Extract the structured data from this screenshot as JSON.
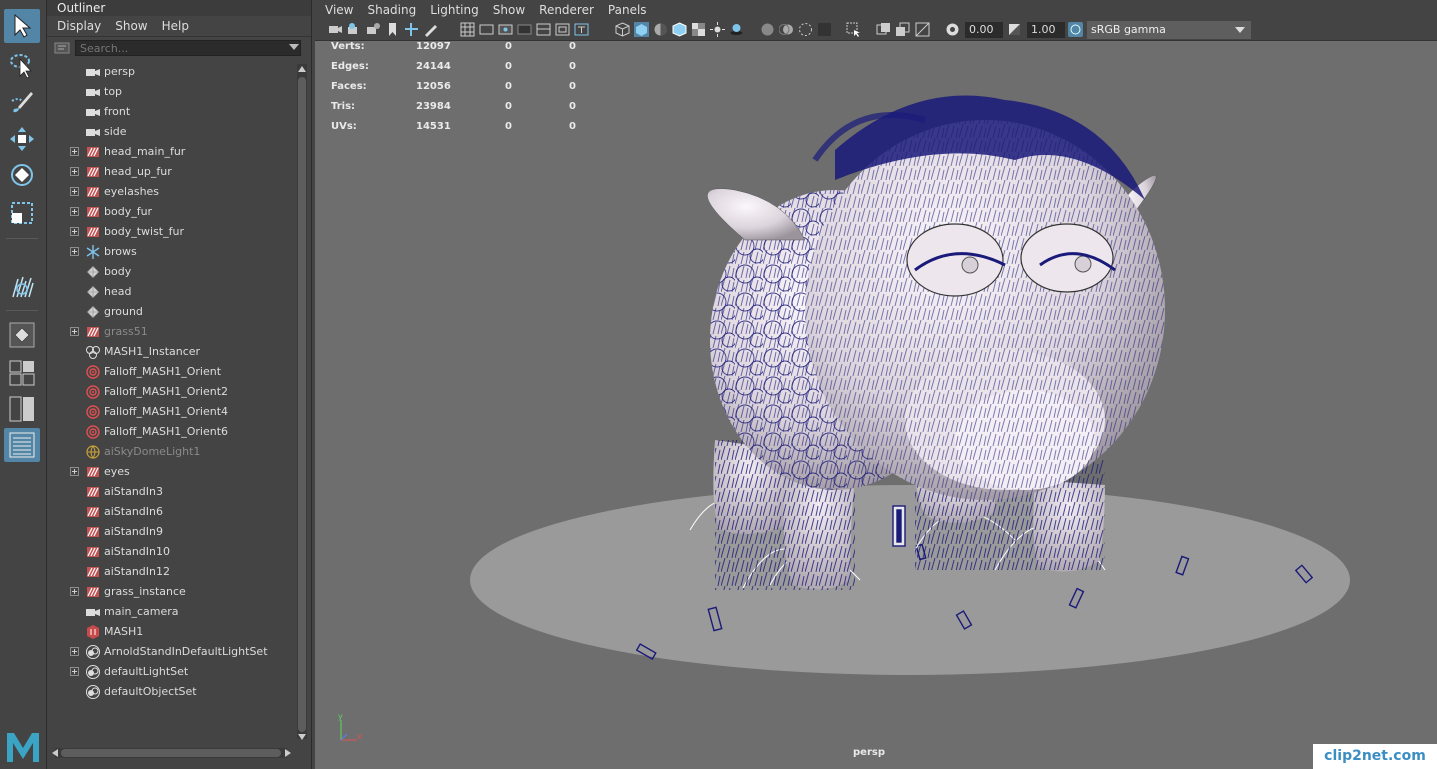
{
  "outliner": {
    "title": "Outliner",
    "menu": [
      "Display",
      "Show",
      "Help"
    ],
    "search_placeholder": "Search...",
    "items": [
      {
        "label": "persp",
        "icon": "camera-icon",
        "expand": false,
        "dim": false
      },
      {
        "label": "top",
        "icon": "camera-icon",
        "expand": false,
        "dim": false
      },
      {
        "label": "front",
        "icon": "camera-icon",
        "expand": false,
        "dim": false
      },
      {
        "label": "side",
        "icon": "camera-icon",
        "expand": false,
        "dim": false
      },
      {
        "label": "head_main_fur",
        "icon": "xgen-icon",
        "expand": true,
        "dim": false
      },
      {
        "label": "head_up_fur",
        "icon": "xgen-icon",
        "expand": true,
        "dim": false
      },
      {
        "label": "eyelashes",
        "icon": "xgen-icon",
        "expand": true,
        "dim": false
      },
      {
        "label": "body_fur",
        "icon": "xgen-icon",
        "expand": true,
        "dim": false
      },
      {
        "label": "body_twist_fur",
        "icon": "xgen-icon",
        "expand": true,
        "dim": false
      },
      {
        "label": "brows",
        "icon": "snowflake-icon",
        "expand": true,
        "dim": false
      },
      {
        "label": "body",
        "icon": "mesh-icon",
        "expand": false,
        "dim": false
      },
      {
        "label": "head",
        "icon": "mesh-icon",
        "expand": false,
        "dim": false
      },
      {
        "label": "ground",
        "icon": "mesh-icon",
        "expand": false,
        "dim": false
      },
      {
        "label": "grass51",
        "icon": "xgen-icon",
        "expand": true,
        "dim": true
      },
      {
        "label": "MASH1_Instancer",
        "icon": "instancer-icon",
        "expand": false,
        "dim": false
      },
      {
        "label": "Falloff_MASH1_Orient",
        "icon": "falloff-icon",
        "expand": false,
        "dim": false
      },
      {
        "label": "Falloff_MASH1_Orient2",
        "icon": "falloff-icon",
        "expand": false,
        "dim": false
      },
      {
        "label": "Falloff_MASH1_Orient4",
        "icon": "falloff-icon",
        "expand": false,
        "dim": false
      },
      {
        "label": "Falloff_MASH1_Orient6",
        "icon": "falloff-icon",
        "expand": false,
        "dim": false
      },
      {
        "label": "aiSkyDomeLight1",
        "icon": "skydome-icon",
        "expand": false,
        "dim": true
      },
      {
        "label": "eyes",
        "icon": "xgen-icon",
        "expand": true,
        "dim": false
      },
      {
        "label": "aiStandIn3",
        "icon": "xgen-icon",
        "expand": false,
        "dim": false
      },
      {
        "label": "aiStandIn6",
        "icon": "xgen-icon",
        "expand": false,
        "dim": false
      },
      {
        "label": "aiStandIn9",
        "icon": "xgen-icon",
        "expand": false,
        "dim": false
      },
      {
        "label": "aiStandIn10",
        "icon": "xgen-icon",
        "expand": false,
        "dim": false
      },
      {
        "label": "aiStandIn12",
        "icon": "xgen-icon",
        "expand": false,
        "dim": false
      },
      {
        "label": "grass_instance",
        "icon": "xgen-icon",
        "expand": true,
        "dim": false
      },
      {
        "label": "main_camera",
        "icon": "camera-icon",
        "expand": false,
        "dim": false
      },
      {
        "label": "MASH1",
        "icon": "mash-icon",
        "expand": false,
        "dim": false
      },
      {
        "label": "ArnoldStandInDefaultLightSet",
        "icon": "set-icon",
        "expand": true,
        "dim": false
      },
      {
        "label": "defaultLightSet",
        "icon": "set-icon",
        "expand": true,
        "dim": false
      },
      {
        "label": "defaultObjectSet",
        "icon": "set-icon",
        "expand": false,
        "dim": false
      }
    ]
  },
  "viewport": {
    "menu": [
      "View",
      "Shading",
      "Lighting",
      "Show",
      "Renderer",
      "Panels"
    ],
    "exposure": "0.00",
    "gamma": "1.00",
    "colorspace": "sRGB gamma",
    "camera_label": "persp",
    "axis_y": "y",
    "axis_x": "x",
    "hud": [
      {
        "label": "Verts:",
        "v1": "12097",
        "v2": "0",
        "v3": "0"
      },
      {
        "label": "Edges:",
        "v1": "24144",
        "v2": "0",
        "v3": "0"
      },
      {
        "label": "Faces:",
        "v1": "12056",
        "v2": "0",
        "v3": "0"
      },
      {
        "label": "Tris:",
        "v1": "23984",
        "v2": "0",
        "v3": "0"
      },
      {
        "label": "UVs:",
        "v1": "14531",
        "v2": "0",
        "v3": "0"
      }
    ]
  },
  "watermark": "clip2net.com",
  "colors": {
    "accent": "#5285a6",
    "fur": "#1a1a7a",
    "ground": "#9a9a9a",
    "viewport_bg": "#6e6e6e"
  }
}
